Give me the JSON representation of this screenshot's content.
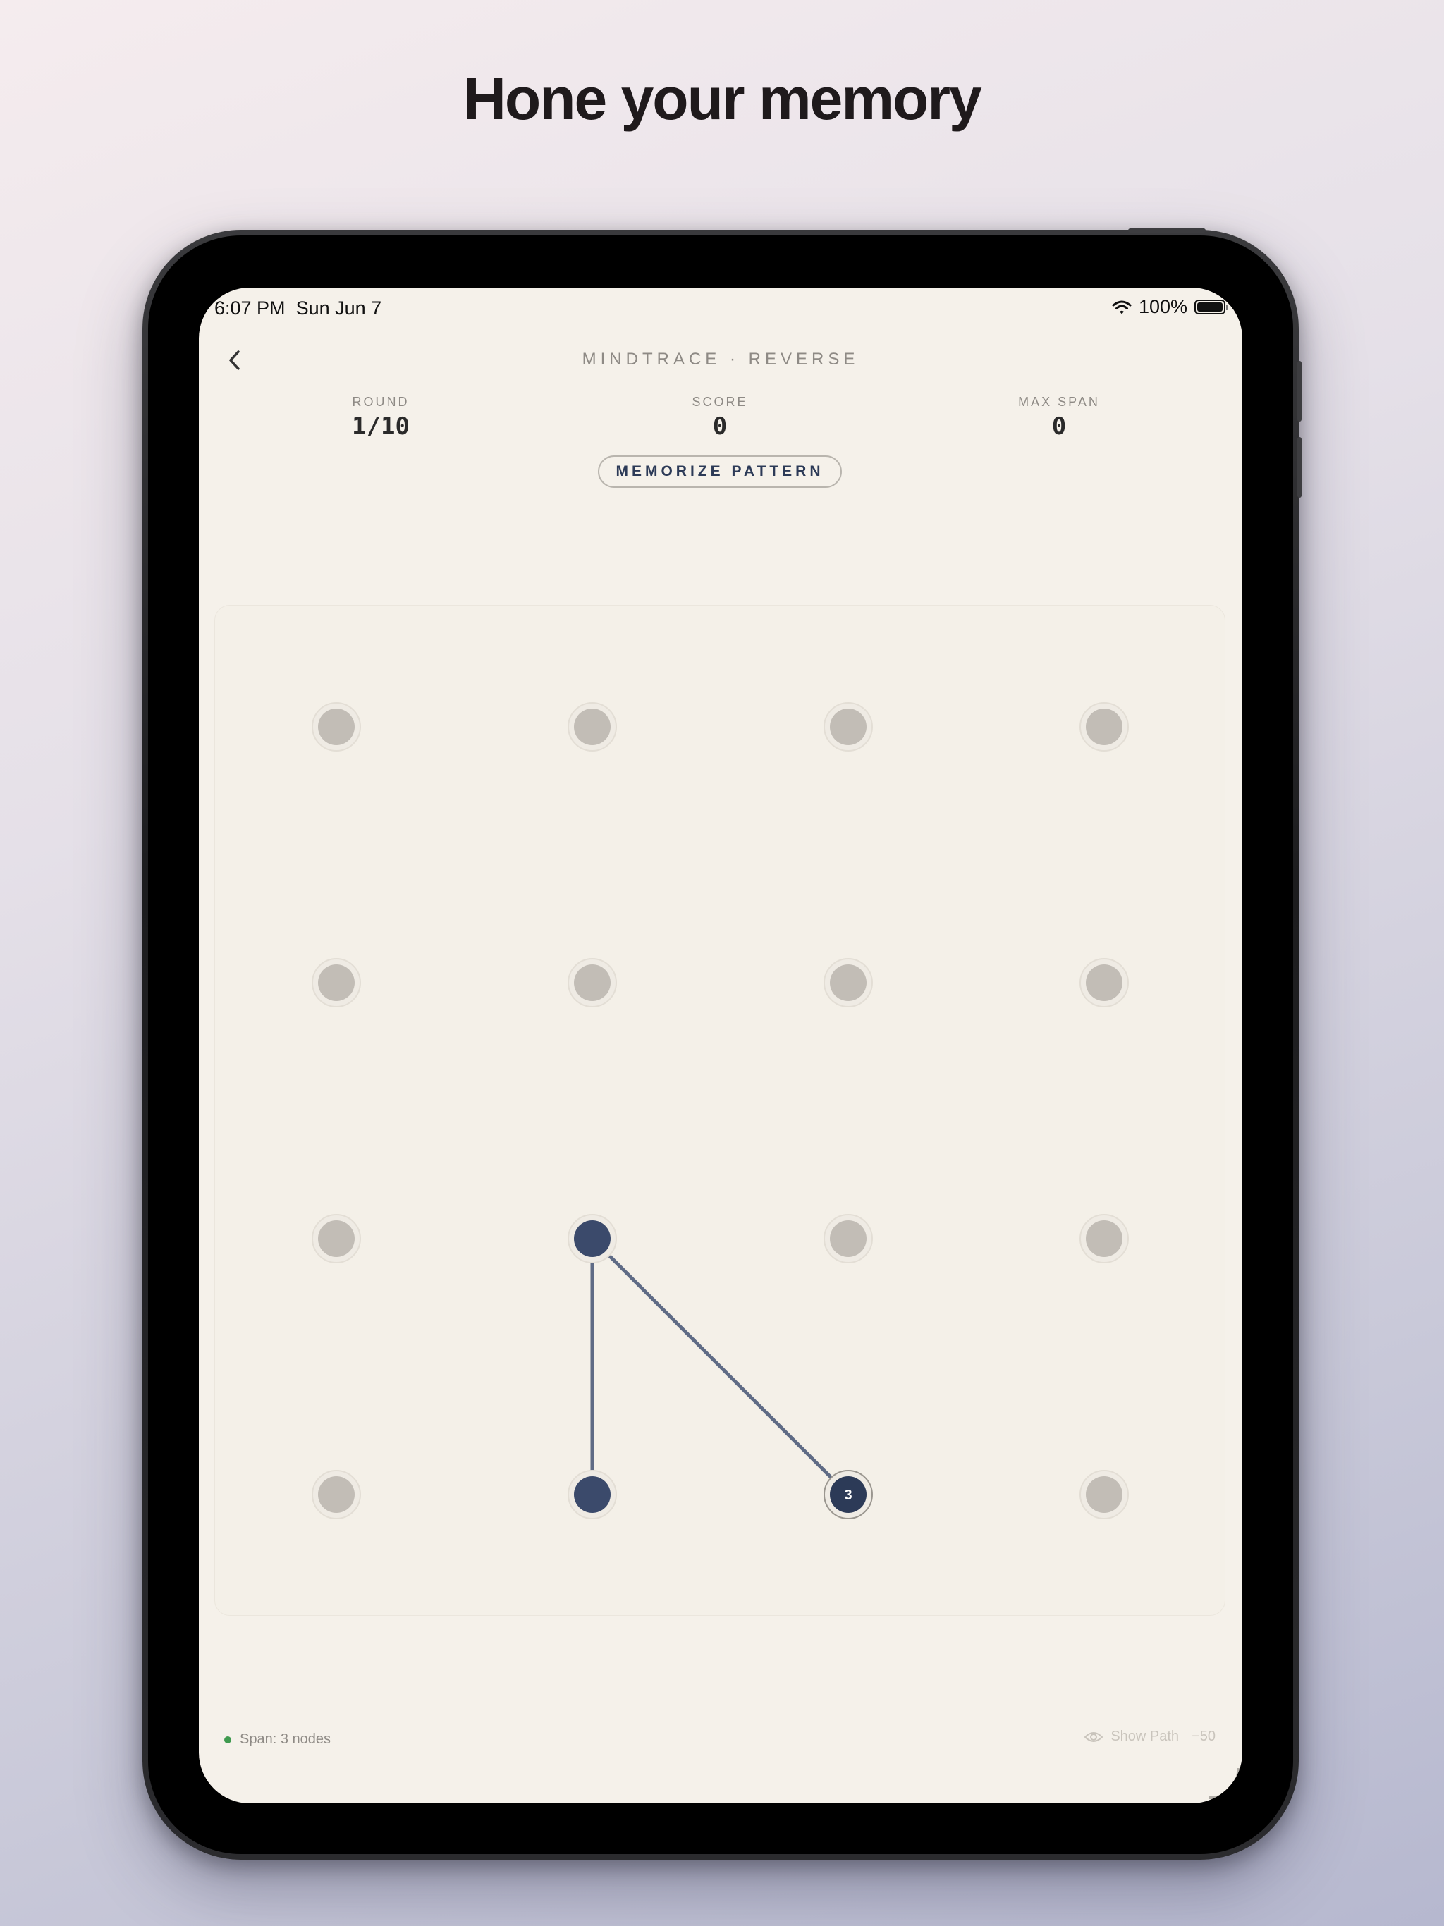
{
  "headline": "Hone your memory",
  "status_bar": {
    "time": "6:07 PM",
    "date": "Sun Jun 7",
    "battery": "100%",
    "icons": [
      "wifi-icon",
      "battery-icon"
    ]
  },
  "header": {
    "back_icon": "chevron-left-icon",
    "title": "MINDTRACE · REVERSE"
  },
  "stats": {
    "round_label": "ROUND",
    "round_value": "1/10",
    "score_label": "SCORE",
    "score_value": "0",
    "max_span_label": "MAX SPAN",
    "max_span_value": "0"
  },
  "phase": "MEMORIZE PATTERN",
  "grid": {
    "rows": 4,
    "cols": 4,
    "path": [
      [
        3,
        1
      ],
      [
        2,
        1
      ],
      [
        3,
        2
      ]
    ],
    "end_label": "3"
  },
  "footer": {
    "span_text": "Span: 3 nodes",
    "show_path_label": "Show Path",
    "show_path_cost": "−50",
    "show_path_icon": "eye-icon"
  },
  "colors": {
    "node_idle": "#c2bdb6",
    "node_active": "#3b4a6b",
    "node_end": "#2c3a57",
    "path_line": "#5f6b85",
    "status_dot": "#3f9a4f"
  }
}
